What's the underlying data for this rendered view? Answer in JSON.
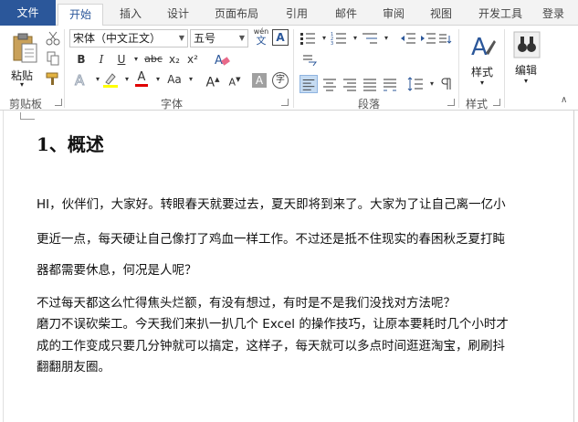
{
  "tabs": {
    "file": "文件",
    "items": [
      "开始",
      "插入",
      "设计",
      "页面布局",
      "引用",
      "邮件",
      "审阅",
      "视图",
      "开发工具",
      "登录"
    ]
  },
  "clipboard": {
    "paste": "粘贴",
    "label": "剪贴板"
  },
  "font": {
    "family": "宋体（中文正文）",
    "size": "五号",
    "wen": "wén",
    "wen2": "文",
    "a_box": "A",
    "bold": "B",
    "italic": "I",
    "underline": "U",
    "strike": "abc",
    "sub": "x₂",
    "sup": "x²",
    "case": "Aa",
    "grow": "A",
    "shrink": "A",
    "char_shade": "A",
    "enclose": "字",
    "label": "字体"
  },
  "paragraph": {
    "label": "段落"
  },
  "styles": {
    "btn": "样式",
    "label": "样式"
  },
  "editing": {
    "btn": "编辑"
  },
  "document": {
    "heading": "1、概述",
    "lines": [
      "HI，伙伴们，大家好。转眼春天就要过去，夏天即将到来了。大家为了让自己离一亿小",
      "更近一点，每天硬让自己像打了鸡血一样工作。不过还是抵不住现实的春困秋乏夏打盹",
      "器都需要休息，何况是人呢？",
      "不过每天都这么忙得焦头烂额，有没有想过，有时是不是我们没找对方法呢？",
      "磨刀不误砍柴工。今天我们来扒一扒几个 Excel 的操作技巧，让原本要耗时几个小时才",
      "成的工作变成只要几分钟就可以搞定，这样子，每天就可以多点时间逛逛淘宝，刷刷抖",
      "翻翻朋友圈。"
    ]
  },
  "colors": {
    "accent": "#2b579a",
    "font_color_bar": "#e00000",
    "highlight_bar": "#ffff00"
  }
}
